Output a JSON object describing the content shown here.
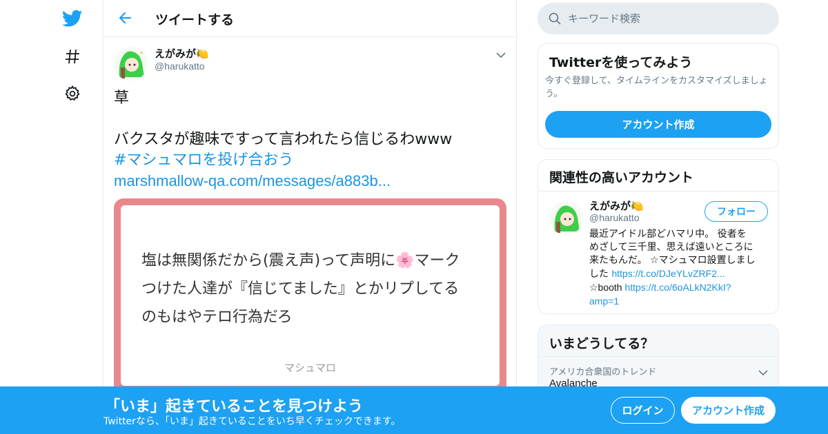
{
  "nav": {
    "icons": [
      "twitter-bird-icon",
      "hashtag-icon",
      "gear-icon"
    ]
  },
  "header": {
    "title": "ツイートする"
  },
  "tweet": {
    "author_name": "えがみが🍋",
    "author_handle": "@harukatto",
    "text_line1": "草",
    "text_line2": "バクスタが趣味ですって言われたら信じるわwww",
    "hashtag": "#マシュマロを投げ合おう",
    "link": "marshmallow-qa.com/messages/a883b...",
    "media": {
      "line1": "塩は無関係だから(震え声)って声明に🌸マーク",
      "line2": "つけた人達が『信じてました』とかリプしてる",
      "line3": "のもはやテロ行為だろ",
      "footer": "マシュマロ"
    }
  },
  "search": {
    "placeholder": "キーワード検索"
  },
  "try_card": {
    "title": "Twitterを使ってみよう",
    "description": "今すぐ登録して、タイムラインをカスタマイズしましょう。",
    "button": "アカウント作成"
  },
  "related": {
    "title": "関連性の高いアカウント",
    "name": "えがみが🍋",
    "handle": "@harukatto",
    "follow": "フォロー",
    "bio_line1": "最近アイドル部どハマリ中。 役者を",
    "bio_line2": "めざして三千里、思えば遠いところに",
    "bio_line3": "来たもんだ。 ☆マシュマロ設置しまし",
    "bio_line4_prefix": "した ",
    "bio_link1": "https://t.co/DJeYLvZRF2...",
    "bio_line5_prefix": "☆booth ",
    "bio_link2": "https://t.co/6oALkN2KkI?",
    "bio_link2_cont": "amp=1"
  },
  "trends": {
    "title": "いまどうしてる？",
    "label": "アメリカ合衆国のトレンド",
    "name": "Avalanche"
  },
  "bottom_bar": {
    "title": "「いま」起きていることを見つけよう",
    "subtitle": "Twitterなら、「いま」起きていることをいち早くチェックできます。",
    "login": "ログイン",
    "signup": "アカウント作成"
  },
  "colors": {
    "brand": "#1da1f2",
    "link": "#1b95e0",
    "card_border": "#e8888d"
  }
}
